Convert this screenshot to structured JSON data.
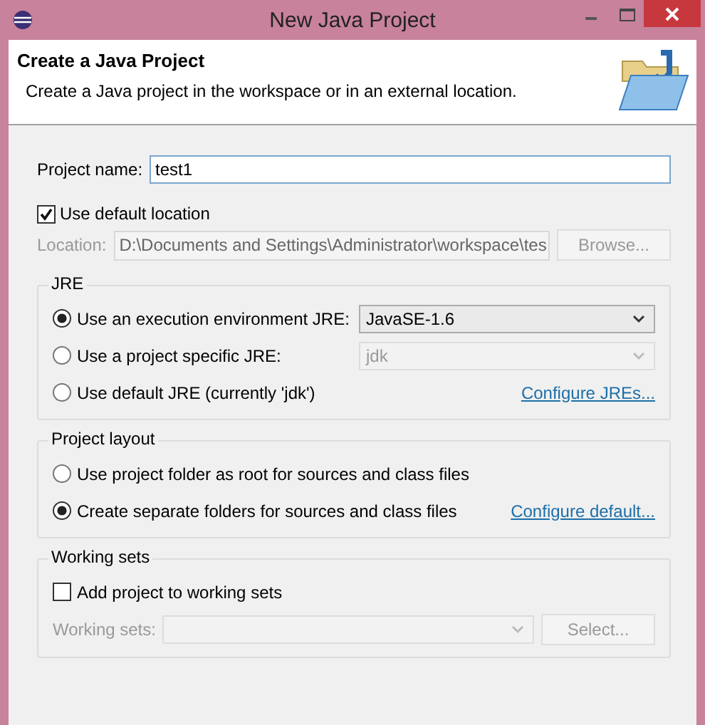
{
  "window": {
    "title": "New Java Project"
  },
  "header": {
    "title": "Create a Java Project",
    "description": "Create a Java project in the workspace or in an external location."
  },
  "project_name": {
    "label": "Project name:",
    "value": "test1"
  },
  "use_default_location": {
    "label": "Use default location",
    "checked": true
  },
  "location": {
    "label": "Location:",
    "value": "D:\\Documents and Settings\\Administrator\\workspace\\tes",
    "disabled": true
  },
  "browse_button": {
    "label": "Browse...",
    "disabled": true
  },
  "jre": {
    "title": "JRE",
    "options": [
      {
        "label": "Use an execution environment JRE:",
        "selected": true,
        "kind": "dropdown",
        "value": "JavaSE-1.6",
        "disabled": false
      },
      {
        "label": "Use a project specific JRE:",
        "selected": false,
        "kind": "dropdown",
        "value": "jdk",
        "disabled": true
      },
      {
        "label": "Use default JRE (currently 'jdk')",
        "selected": false,
        "kind": "link",
        "link": "Configure JREs..."
      }
    ]
  },
  "project_layout": {
    "title": "Project layout",
    "options": [
      {
        "label": "Use project folder as root for sources and class files",
        "selected": false,
        "kind": "plain"
      },
      {
        "label": "Create separate folders for sources and class files",
        "selected": true,
        "kind": "link",
        "link": "Configure default..."
      }
    ]
  },
  "working_sets": {
    "title": "Working sets",
    "checkbox": {
      "label": "Add project to working sets",
      "checked": false
    },
    "label": "Working sets:",
    "disabled": true,
    "button": "Select..."
  }
}
